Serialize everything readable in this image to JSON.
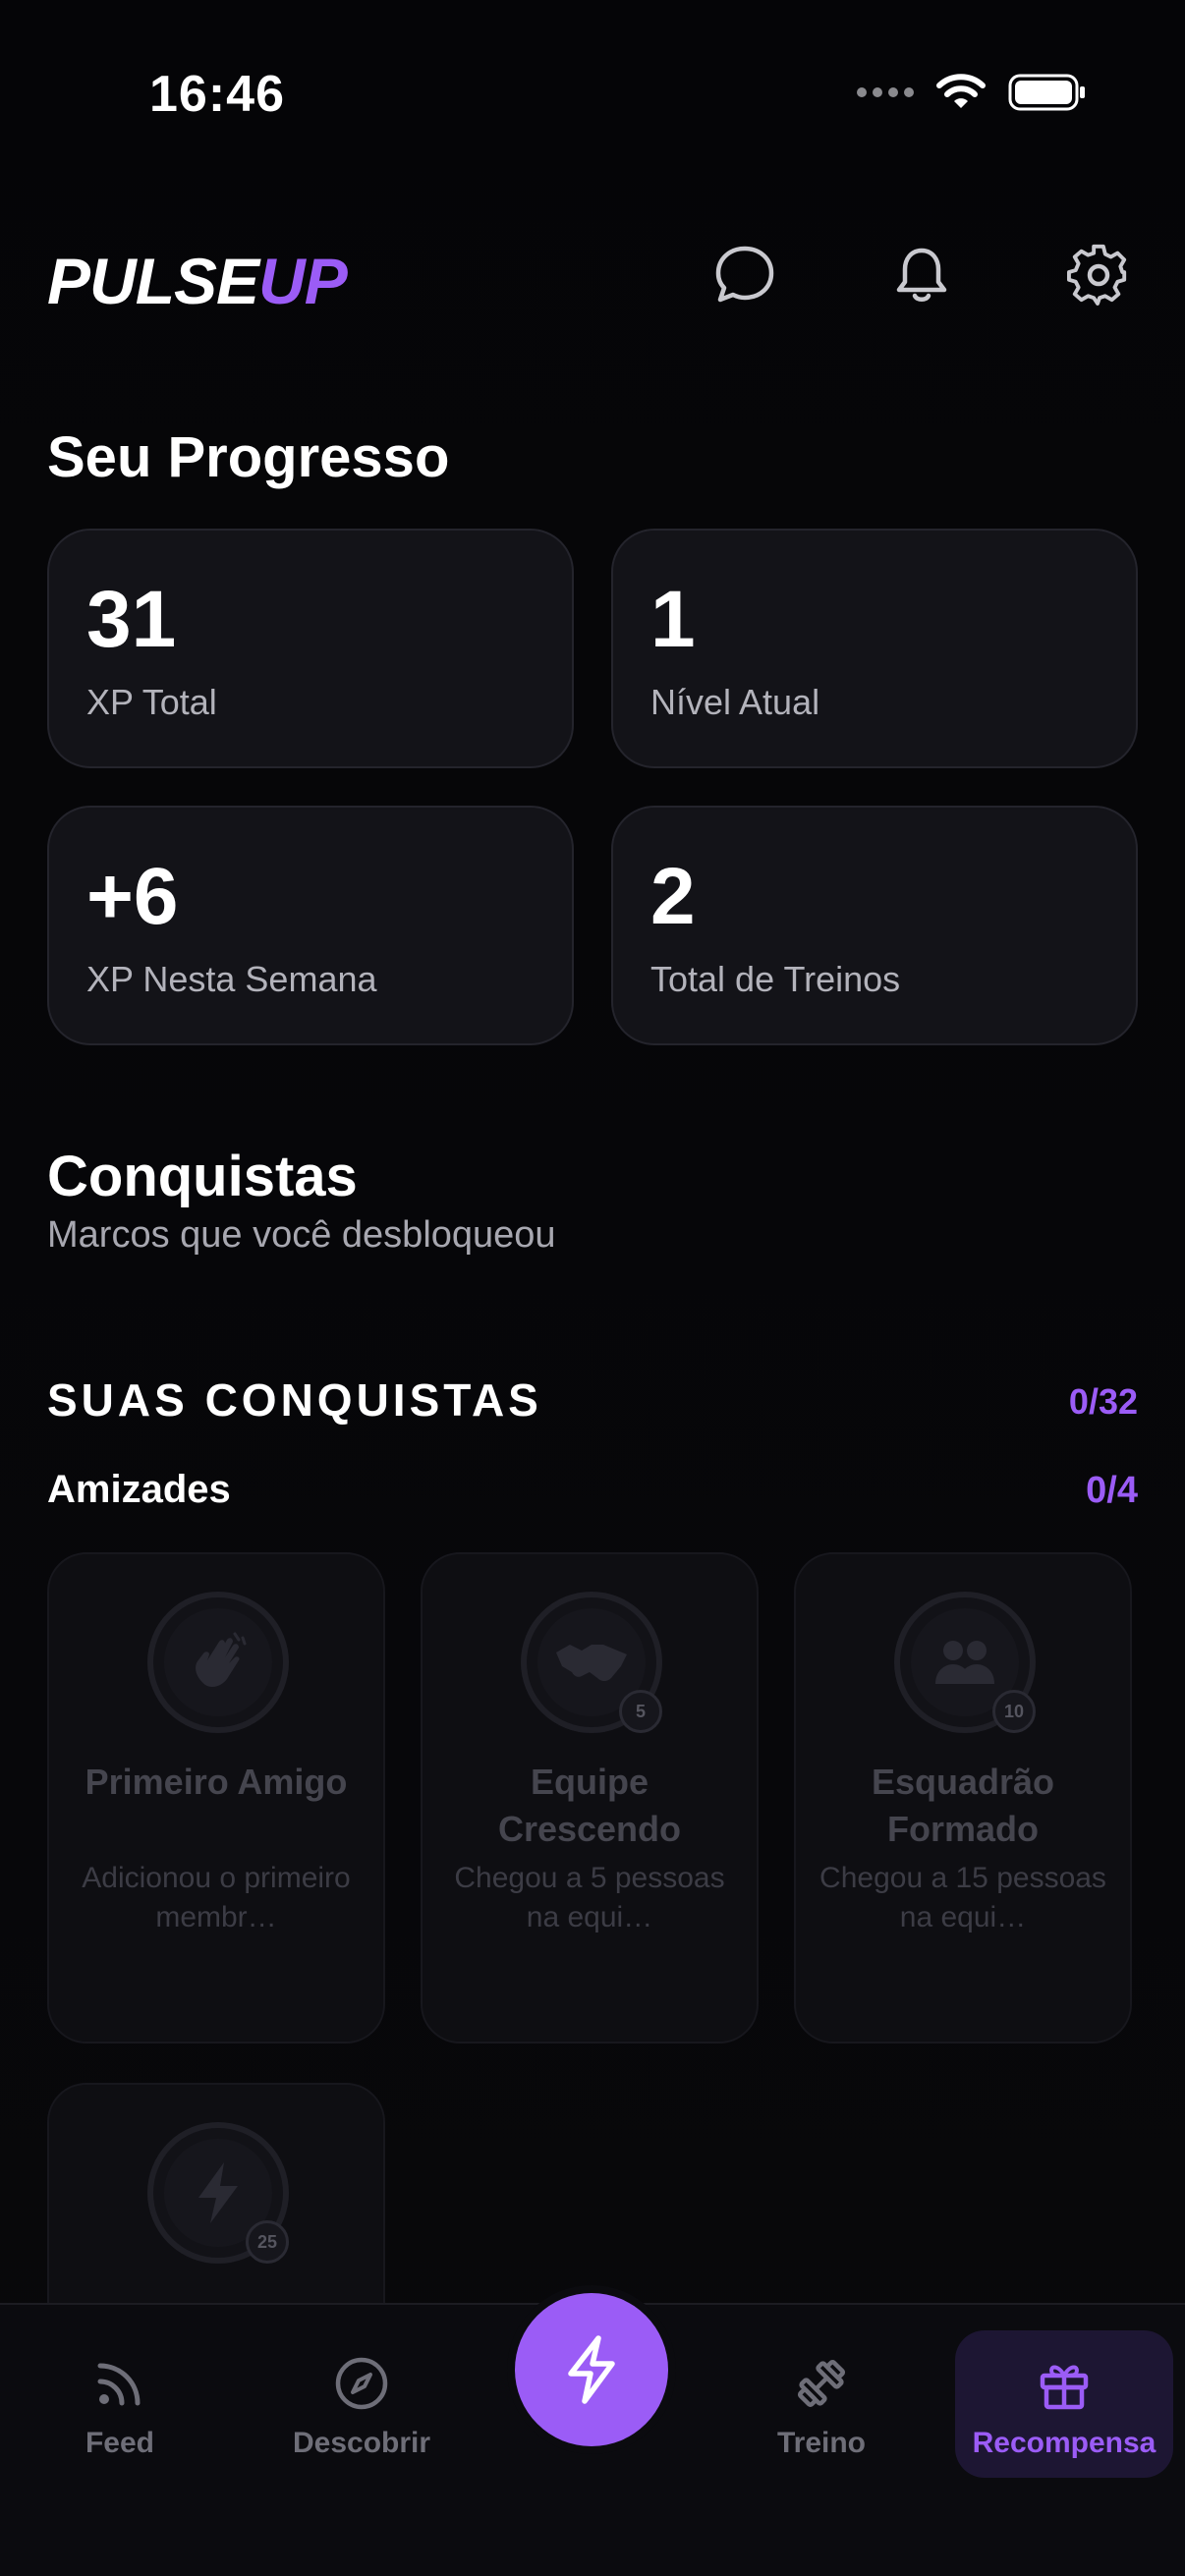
{
  "status_bar": {
    "time": "16:46"
  },
  "header": {
    "logo": {
      "part1": "PU",
      "part2": "LSE",
      "part3": "UP"
    }
  },
  "progress": {
    "title": "Seu Progresso",
    "cards": [
      {
        "value": "31",
        "label": "XP Total"
      },
      {
        "value": "1",
        "label": "Nível Atual"
      },
      {
        "value": "+6",
        "label": "XP Nesta Semana"
      },
      {
        "value": "2",
        "label": "Total de Treinos"
      }
    ]
  },
  "achievements": {
    "title": "Conquistas",
    "subtitle": "Marcos que você desbloqueou",
    "section_title": "SUAS CONQUISTAS",
    "section_count": "0/32",
    "category": {
      "title": "Amizades",
      "count": "0/4"
    },
    "items": [
      {
        "title": "Primeiro Amigo",
        "description": "Adicionou o primeiro membr…",
        "icon": "waving-hand-icon",
        "badge_number": ""
      },
      {
        "title": "Equipe Crescendo",
        "description": "Chegou a 5 pessoas na equi…",
        "icon": "handshake-icon",
        "badge_number": "5"
      },
      {
        "title": "Esquadrão Formado",
        "description": "Chegou a 15 pessoas na equi…",
        "icon": "group-icon",
        "badge_number": "10"
      },
      {
        "title": "",
        "description": "",
        "icon": "lightning-icon",
        "badge_number": "25"
      }
    ]
  },
  "bottom_nav": {
    "items": [
      {
        "label": "Feed",
        "icon": "rss-icon"
      },
      {
        "label": "Descobrir",
        "icon": "compass-icon"
      },
      {
        "label": "Treino",
        "icon": "dumbbell-icon"
      },
      {
        "label": "Recompensa",
        "icon": "gift-icon",
        "active": true
      }
    ],
    "center_action_icon": "lightning-icon"
  },
  "colors": {
    "accent": "#9b5cf6",
    "background": "#050507",
    "card": "#131318"
  }
}
